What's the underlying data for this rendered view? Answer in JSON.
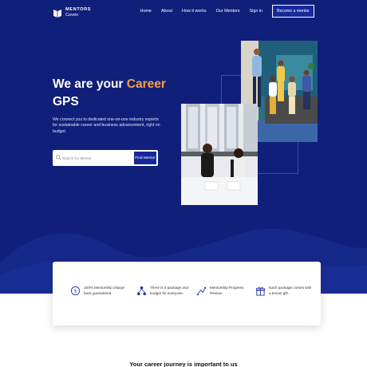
{
  "nav": {
    "logo": {
      "line1": "MENTORS",
      "line2": "Coven"
    },
    "links": [
      {
        "label": "Home"
      },
      {
        "label": "About"
      },
      {
        "label": "How it works"
      },
      {
        "label": "Our Mentors"
      },
      {
        "label": "Sign in"
      }
    ],
    "cta_label": "Become a mentor"
  },
  "hero": {
    "headline_prefix": "We are your ",
    "headline_accent": "Career",
    "headline_suffix": "GPS",
    "subtext": "We connect you to dedicated one-on-one industry experts for sustainable career and business advancement, right on budget.",
    "search": {
      "placeholder": "Search for Mentor",
      "button_label": "Find Mentor"
    }
  },
  "features": [
    {
      "icon": "money-back-icon",
      "text": "100% Mentorship charge back guaranteed."
    },
    {
      "icon": "package-network-icon",
      "text": "There is a package and budget for everyone."
    },
    {
      "icon": "progress-review-icon",
      "text": "Mentorship Progress Review."
    },
    {
      "icon": "gift-icon",
      "text": "Each package comes with a bonus gift."
    }
  ],
  "next_section": {
    "title": "Your career journey is important to us"
  },
  "colors": {
    "hero_bg": "#101f7a",
    "accent": "#f2a23e",
    "button": "#16279b"
  }
}
